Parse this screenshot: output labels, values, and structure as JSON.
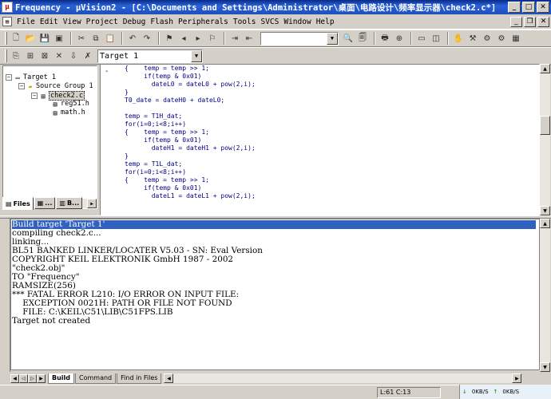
{
  "window": {
    "title": "Frequency  - µVision2 - [C:\\Documents and Settings\\Administrator\\桌面\\电路设计\\频率显示器\\check2.c*]",
    "min_label": "_",
    "max_label": "□",
    "close_label": "✕"
  },
  "menu": {
    "items": [
      "File",
      "Edit",
      "View",
      "Project",
      "Debug",
      "Flash",
      "Peripherals",
      "Tools",
      "SVCS",
      "Window",
      "Help"
    ]
  },
  "toolbar": {
    "find_combo_value": "",
    "target_combo_value": "Target 1"
  },
  "project_tree": {
    "root": "Target 1",
    "group": "Source Group 1",
    "file": "check2.c",
    "children": [
      "reg51.h",
      "math.h"
    ],
    "tabs": [
      "Files",
      "...",
      "B..."
    ]
  },
  "editor": {
    "lines": [
      "{    temp = temp >> 1;",
      "     if(temp & 0x01)",
      "       dateL0 = dateL0 + pow(2,i);",
      "}",
      "T0_date = dateH0 + dateL0;",
      "",
      "temp = T1H_dat;",
      "for(i=0;i<8;i++)",
      "{    temp = temp >> 1;",
      "     if(temp & 0x01)",
      "       dateH1 = dateH1 + pow(2,i);",
      "}",
      "temp = T1L_dat;",
      "for(i=0;i<8;i++)",
      "{    temp = temp >> 1;",
      "     if(temp & 0x01)",
      "       dateL1 = dateL1 + pow(2,i);"
    ]
  },
  "output": {
    "lines": [
      "Build target 'Target 1'",
      "compiling check2.c...",
      "linking...",
      "BL51 BANKED LINKER/LOCATER V5.03 - SN: Eval Version",
      "COPYRIGHT KEIL ELEKTRONIK GmbH 1987 - 2002",
      "\"check2.obj\"",
      "TO \"Frequency\"",
      "RAMSIZE(256)",
      "*** FATAL ERROR L210: I/O ERROR ON INPUT FILE:",
      "    EXCEPTION 0021H: PATH OR FILE NOT FOUND",
      "    FILE: C:\\KEIL\\C51\\LIB\\C51FPS.LIB",
      "Target not created"
    ],
    "tabs": [
      "Build",
      "Command",
      "Find in Files"
    ]
  },
  "status": {
    "position": "L:61 C:13",
    "net_down": "0KB/S",
    "net_up": "0KB/S"
  }
}
